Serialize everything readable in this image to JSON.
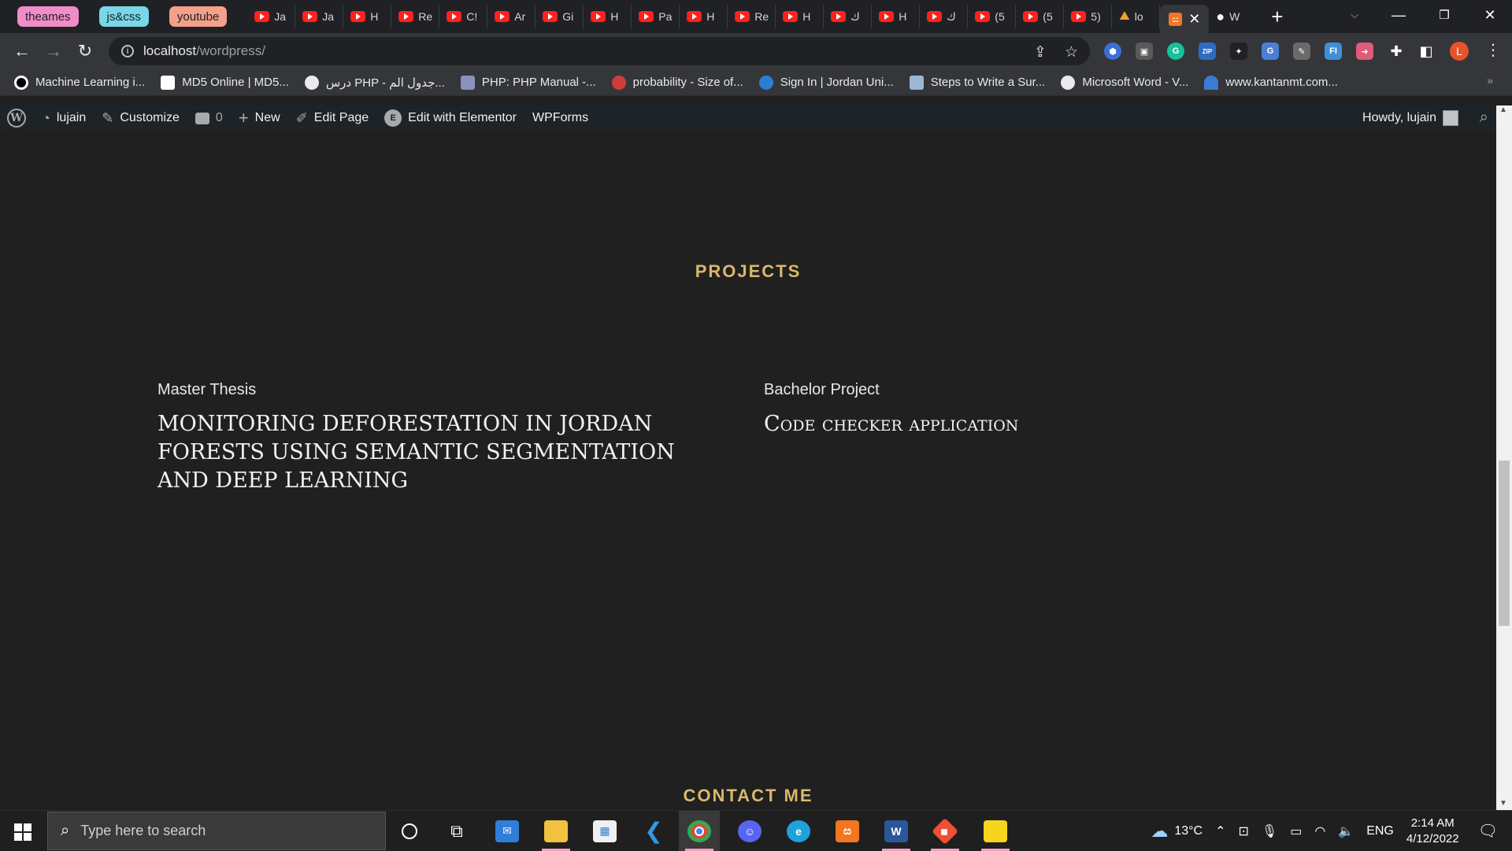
{
  "browser": {
    "tab_groups": [
      {
        "label": "theames",
        "color": "#f08cc8"
      },
      {
        "label": "js&css",
        "color": "#78d7e8"
      },
      {
        "label": "youtube",
        "color": "#f4a08a"
      }
    ],
    "tabs": [
      {
        "label": "Ja",
        "icon": "youtube-icon"
      },
      {
        "label": "Ja",
        "icon": "youtube-icon"
      },
      {
        "label": "H",
        "icon": "youtube-icon"
      },
      {
        "label": "Re",
        "icon": "youtube-icon"
      },
      {
        "label": "C!",
        "icon": "youtube-icon"
      },
      {
        "label": "Ar",
        "icon": "youtube-icon"
      },
      {
        "label": "Gi",
        "icon": "youtube-icon"
      },
      {
        "label": "H",
        "icon": "youtube-icon"
      },
      {
        "label": "Pa",
        "icon": "youtube-icon"
      },
      {
        "label": "H",
        "icon": "youtube-icon"
      },
      {
        "label": "Re",
        "icon": "youtube-icon"
      },
      {
        "label": "H",
        "icon": "youtube-icon"
      },
      {
        "label": "ك",
        "icon": "youtube-icon"
      },
      {
        "label": "H",
        "icon": "youtube-icon"
      },
      {
        "label": "ك",
        "icon": "youtube-icon"
      },
      {
        "label": "(5",
        "icon": "youtube-icon"
      },
      {
        "label": "(5",
        "icon": "youtube-icon"
      },
      {
        "label": "5)",
        "icon": "youtube-icon"
      },
      {
        "label": "lo",
        "icon": "matlab-icon"
      }
    ],
    "active_tab_icon": "xampp-icon",
    "after_tab": {
      "label": "W",
      "icon": "github-icon"
    },
    "address": {
      "host": "localhost",
      "path": "/wordpress/"
    },
    "profile_initial": "L"
  },
  "bookmarks": [
    {
      "label": "Machine Learning i...",
      "color": "#ffffff"
    },
    {
      "label": "MD5 Online | MD5...",
      "color": "#ffffff"
    },
    {
      "label": "درس PHP - جدول الم...",
      "color": "#e8eaed"
    },
    {
      "label": "PHP: PHP Manual -...",
      "color": "#8892bf"
    },
    {
      "label": "probability - Size of...",
      "color": "#d23b3b"
    },
    {
      "label": "Sign In | Jordan Uni...",
      "color": "#2a7fd4"
    },
    {
      "label": "Steps to Write a Sur...",
      "color": "#9bb7d4"
    },
    {
      "label": "Microsoft Word - V...",
      "color": "#e8eaed"
    },
    {
      "label": "www.kantanmt.com...",
      "color": "#3a7bd5"
    }
  ],
  "wp_admin_bar": {
    "site_name": "lujain",
    "customize": "Customize",
    "comments_count": "0",
    "new": "New",
    "edit_page": "Edit Page",
    "elementor": "Edit with Elementor",
    "wpforms": "WPForms",
    "howdy": "Howdy, lujain"
  },
  "page": {
    "section_title": "PROJECTS",
    "projects": [
      {
        "kicker": "Master Thesis",
        "title": "MONITORING DEFORESTATION IN JORDAN FORESTS USING SEMANTIC SEGMENTATION AND DEEP LEARNING"
      },
      {
        "kicker": "Bachelor Project",
        "title": "Code checker application"
      }
    ],
    "contact_title": "CONTACT ME",
    "accent_color": "#d9b86b"
  },
  "taskbar": {
    "search_placeholder": "Type here to search",
    "apps": [
      "cortana-icon",
      "task-view-icon",
      "mail-icon",
      "file-explorer-icon",
      "store-icon",
      "vscode-icon",
      "chrome-icon",
      "discord-icon",
      "edge-icon",
      "xampp-icon",
      "word-icon",
      "git-icon",
      "sticky-notes-icon"
    ],
    "weather": "13°C",
    "language": "ENG",
    "time": "2:14 AM",
    "date": "4/12/2022"
  }
}
